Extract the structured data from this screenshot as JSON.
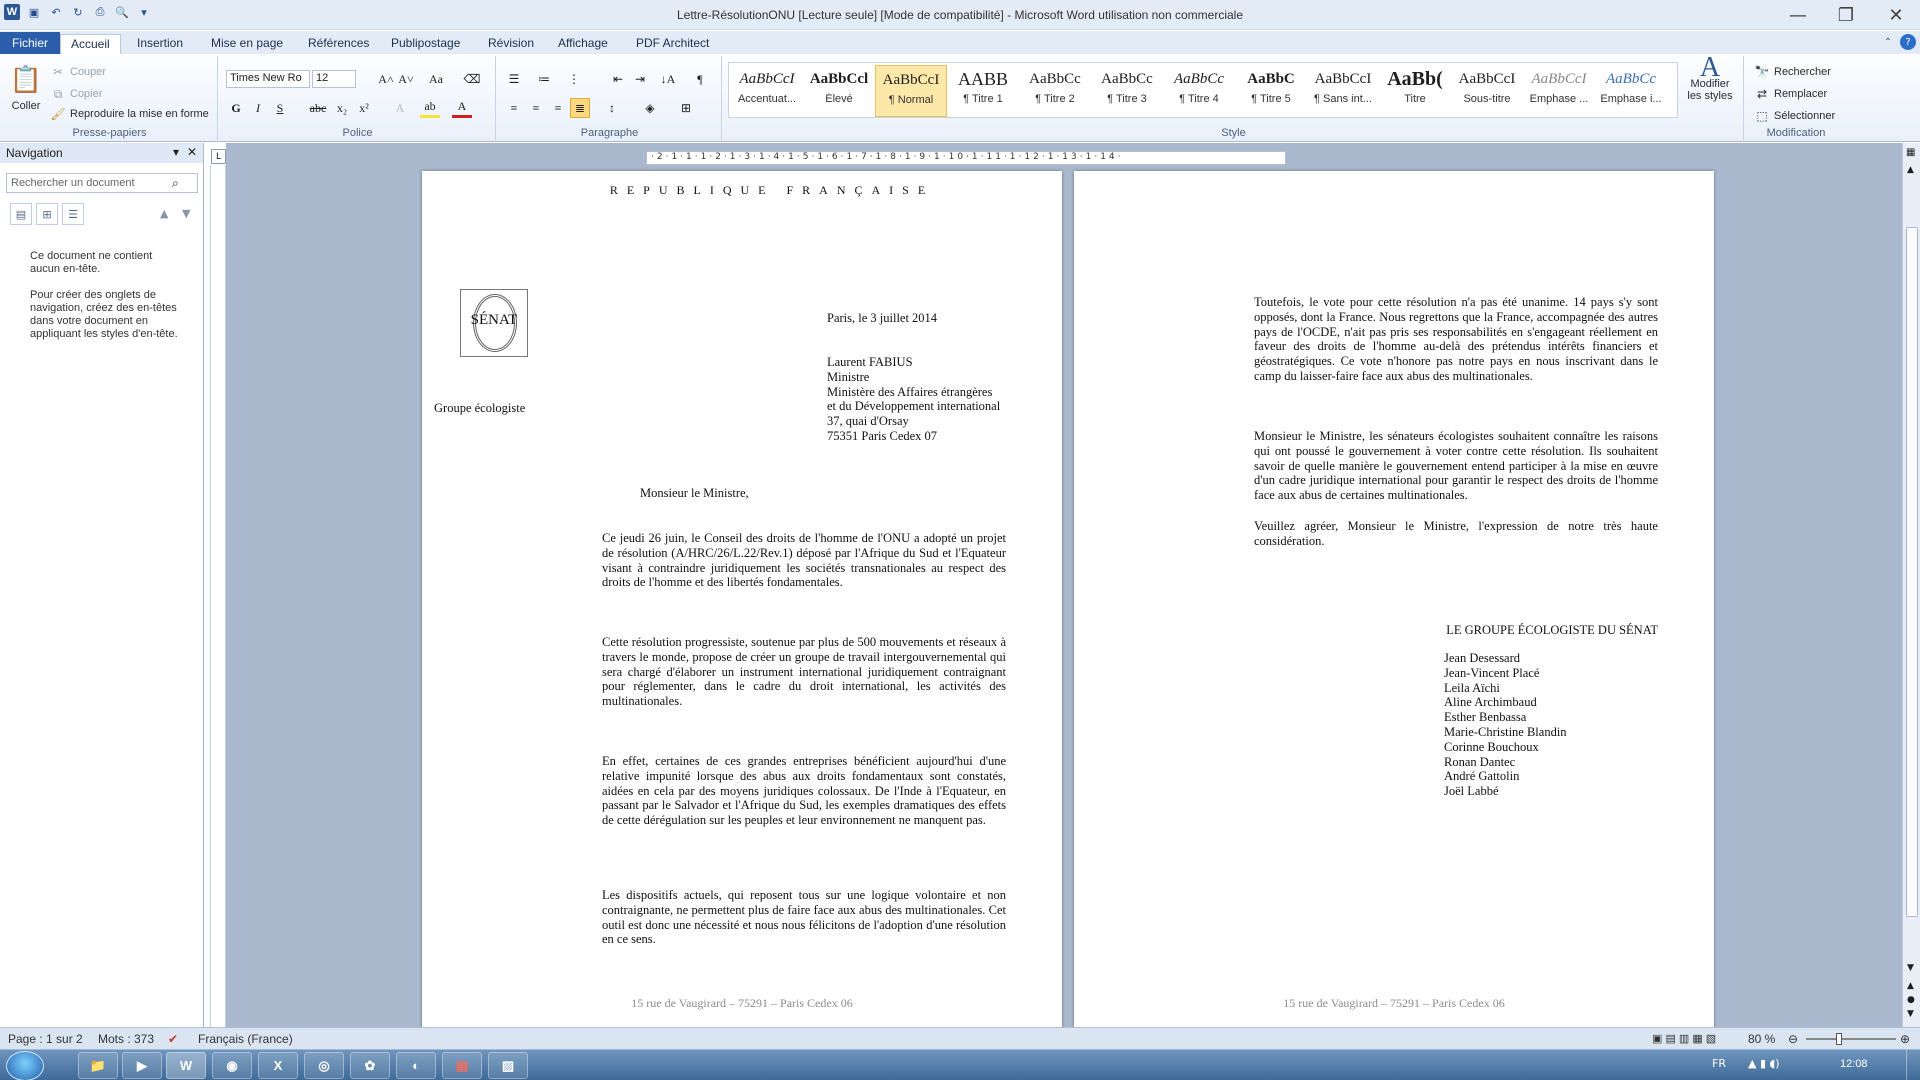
{
  "window": {
    "title": "Lettre-RésolutionONU [Lecture seule] [Mode de compatibilité]  -  Microsoft Word utilisation non commerciale",
    "app_letter": "W"
  },
  "tabs": [
    "Fichier",
    "Accueil",
    "Insertion",
    "Mise en page",
    "Références",
    "Publipostage",
    "Révision",
    "Affichage",
    "PDF Architect"
  ],
  "ribbon": {
    "clipboard": {
      "paste": "Coller",
      "cut": "Couper",
      "copy": "Copier",
      "format_painter": "Reproduire la mise en forme",
      "label": "Presse-papiers"
    },
    "font": {
      "name": "Times New Ro",
      "size": "12",
      "label": "Police"
    },
    "paragraph": {
      "label": "Paragraphe"
    },
    "styles": {
      "label": "Style",
      "items": [
        {
          "sample": "AaBbCcI",
          "name": "Accentuat..."
        },
        {
          "sample": "AaBbCcl",
          "name": "Élevé"
        },
        {
          "sample": "AaBbCcI",
          "name": "¶ Normal"
        },
        {
          "sample": "AABB",
          "name": "¶ Titre 1"
        },
        {
          "sample": "AaBbCc",
          "name": "¶ Titre 2"
        },
        {
          "sample": "AaBbCc",
          "name": "¶ Titre 3"
        },
        {
          "sample": "AaBbCc",
          "name": "¶ Titre 4"
        },
        {
          "sample": "AaBbC",
          "name": "¶ Titre 5"
        },
        {
          "sample": "AaBbCcI",
          "name": "¶ Sans int..."
        },
        {
          "sample": "AaBb(",
          "name": "Titre"
        },
        {
          "sample": "AaBbCcI",
          "name": "Sous-titre"
        },
        {
          "sample": "AaBbCcI",
          "name": "Emphase ..."
        },
        {
          "sample": "AaBbCc",
          "name": "Emphase i..."
        }
      ],
      "modify": "Modifier les styles"
    },
    "editing": {
      "find": "Rechercher",
      "replace": "Remplacer",
      "select": "Sélectionner",
      "label": "Modification"
    }
  },
  "navigation": {
    "title": "Navigation",
    "search_placeholder": "Rechercher un document",
    "msg1": "Ce document ne contient aucun en-tête.",
    "msg2": "Pour créer des onglets de navigation, créez des en-têtes dans votre document en appliquant les styles d'en-tête."
  },
  "page1": {
    "header": "REPUBLIQUE FRANÇAISE",
    "logo_text": "SÉNAT",
    "group": "Groupe écologiste",
    "date": "Paris, le 3 juillet 2014",
    "recipient": [
      "Laurent FABIUS",
      "Ministre",
      "Ministère des Affaires étrangères",
      "et du Développement international",
      "37, quai d'Orsay",
      "75351 Paris Cedex 07"
    ],
    "salutation": "Monsieur le Ministre,",
    "p1": "Ce jeudi 26 juin, le Conseil des droits de l'homme de l'ONU a adopté un projet de résolution (A/HRC/26/L.22/Rev.1) déposé par l'Afrique du Sud et l'Equateur visant à contraindre juridiquement les sociétés transnationales au respect des droits de l'homme et des libertés fondamentales.",
    "p2": "Cette résolution progressiste, soutenue par plus de 500 mouvements et réseaux à travers le monde, propose de créer un groupe de travail intergouvernemental qui sera chargé d'élaborer un instrument international juridiquement contraignant pour réglementer, dans le cadre du droit international, les activités des multinationales.",
    "p3": "En effet, certaines de ces grandes entreprises bénéficient aujourd'hui d'une relative impunité lorsque des abus aux droits fondamentaux sont constatés, aidées en cela par des moyens juridiques colossaux. De l'Inde à l'Equateur, en passant par le Salvador et l'Afrique du Sud, les exemples dramatiques des effets de cette dérégulation sur les peuples et leur environnement ne manquent pas.",
    "p4": "Les dispositifs actuels, qui reposent tous sur une logique volontaire et non contraignante, ne permettent plus de faire face aux abus des multinationales. Cet outil est donc une nécessité et nous nous félicitons de l'adoption d'une résolution en ce sens.",
    "footer": "15 rue de Vaugirard – 75291 – Paris Cedex 06"
  },
  "page2": {
    "p1": "Toutefois, le vote pour cette résolution n'a pas été unanime. 14 pays s'y sont opposés, dont la France. Nous regrettons que la France, accompagnée des autres pays de l'OCDE, n'ait pas pris ses responsabilités en s'engageant réellement en faveur des droits de l'homme au-delà des prétendus intérêts financiers et géostratégiques. Ce vote n'honore pas notre pays en nous inscrivant dans le camp du laisser-faire face aux abus des multinationales.",
    "p2": "Monsieur le Ministre, les sénateurs écologistes souhaitent connaître les raisons qui ont poussé le gouvernement à voter contre cette résolution. Ils souhaitent savoir de quelle manière le gouvernement entend participer à la mise en œuvre d'un cadre juridique international pour garantir le respect des droits de l'homme face aux abus de certaines multinationales.",
    "p3": "Veuillez agréer, Monsieur le Ministre, l'expression de notre très haute considération.",
    "signature_title": "LE GROUPE ÉCOLOGISTE DU SÉNAT",
    "signatories": [
      "Jean Desessard",
      "Jean-Vincent Placé",
      "Leila Aïchi",
      "Aline Archimbaud",
      "Esther Benbassa",
      "Marie-Christine Blandin",
      "Corinne Bouchoux",
      "Ronan Dantec",
      "André Gattolin",
      "Joël Labbé"
    ],
    "footer": "15 rue de Vaugirard – 75291 – Paris Cedex 06"
  },
  "status": {
    "page": "Page : 1 sur 2",
    "words": "Mots : 373",
    "language": "Français (France)",
    "zoom": "80 %"
  },
  "taskbar": {
    "lang": "FR",
    "time": "12:08"
  }
}
